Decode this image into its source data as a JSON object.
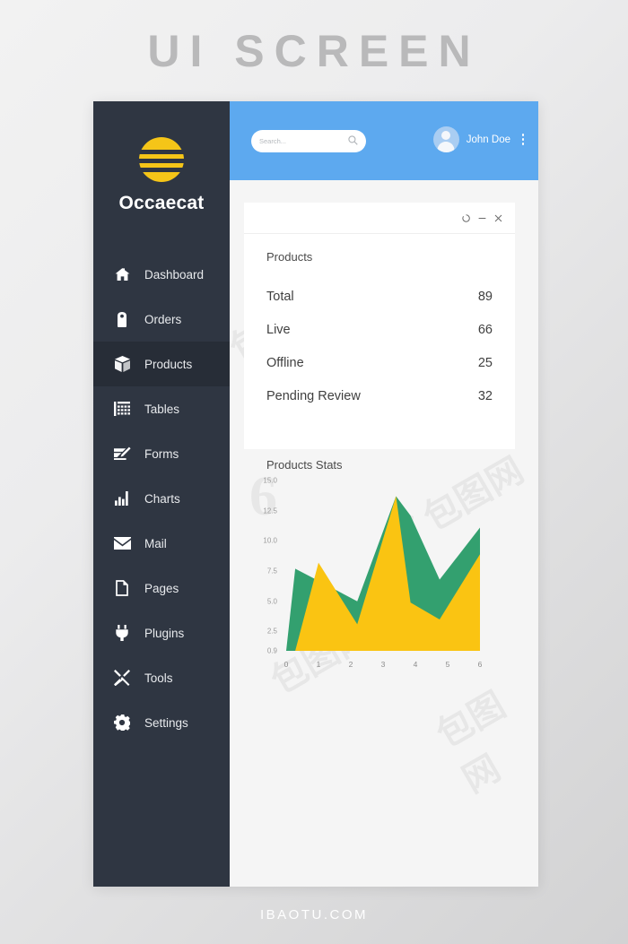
{
  "poster": {
    "title": "UI SCREEN",
    "footer": "IBAOTU.COM"
  },
  "colors": {
    "sidebar_bg": "#2f3642",
    "sidebar_active": "#272d37",
    "topbar_blue": "#5da9ef",
    "accent_yellow": "#f5c518",
    "chart_yellow": "#fac412",
    "chart_green": "#33a06f",
    "content_bg": "#f5f5f5",
    "card_bg": "#ffffff",
    "poster_title": "#b9b9ba"
  },
  "sidebar": {
    "brand": "Occaecat",
    "logo_icon": "striped-circle-logo",
    "items": [
      {
        "label": "Dashboard",
        "icon": "home-icon",
        "active": false
      },
      {
        "label": "Orders",
        "icon": "tag-icon",
        "active": false
      },
      {
        "label": "Products",
        "icon": "box-icon",
        "active": true
      },
      {
        "label": "Tables",
        "icon": "grid-icon",
        "active": false
      },
      {
        "label": "Forms",
        "icon": "form-pencil-icon",
        "active": false
      },
      {
        "label": "Charts",
        "icon": "bar-chart-icon",
        "active": false
      },
      {
        "label": "Mail",
        "icon": "envelope-icon",
        "active": false
      },
      {
        "label": "Pages",
        "icon": "page-icon",
        "active": false
      },
      {
        "label": "Plugins",
        "icon": "plug-icon",
        "active": false
      },
      {
        "label": "Tools",
        "icon": "wrench-screwdriver-icon",
        "active": false
      },
      {
        "label": "Settings",
        "icon": "gear-icon",
        "active": false
      }
    ]
  },
  "topbar": {
    "search": {
      "placeholder": "Search...",
      "value": "",
      "icon": "search-icon"
    },
    "user": {
      "name": "John Doe",
      "avatar_icon": "avatar-icon"
    },
    "menu_icon": "kebab-menu-icon"
  },
  "products_card": {
    "window_controls": [
      {
        "name": "refresh",
        "icon": "refresh-icon"
      },
      {
        "name": "minimize",
        "icon": "minimize-icon"
      },
      {
        "name": "close",
        "icon": "close-icon"
      }
    ],
    "title": "Products",
    "rows": [
      {
        "label": "Total",
        "value": "89"
      },
      {
        "label": "Live",
        "value": "66"
      },
      {
        "label": "Offline",
        "value": "25"
      },
      {
        "label": "Pending Review",
        "value": "32"
      }
    ]
  },
  "chart_data": {
    "type": "area",
    "title": "Products Stats",
    "xlabel": "",
    "ylabel": "",
    "x": [
      0,
      1,
      2,
      3,
      4,
      5,
      6
    ],
    "xlim": [
      0,
      6
    ],
    "ylim": [
      0.9,
      15.0
    ],
    "ytick_labels": [
      "0.9",
      "2.5",
      "5.0",
      "7.5",
      "10.0",
      "12.5",
      "15.0"
    ],
    "yticks": [
      0.9,
      2.5,
      5.0,
      7.5,
      10.0,
      12.5,
      15.0
    ],
    "xtick_labels": [
      "0",
      "1",
      "2",
      "3",
      "4",
      "5",
      "6"
    ],
    "grid": false,
    "legend": "none",
    "series": [
      {
        "name": "series-green",
        "color": "#33a06f",
        "values": [
          0.9,
          7.7,
          6.7,
          5.0,
          13.7,
          12.1,
          6.8,
          11.1
        ]
      },
      {
        "name": "series-yellow",
        "color": "#fac412",
        "values": [
          0.9,
          0.9,
          8.2,
          3.1,
          13.7,
          4.9,
          3.5,
          8.9
        ]
      }
    ],
    "series_x": [
      0,
      0.28,
      1,
      2.2,
      3.4,
      3.85,
      4.75,
      6
    ]
  },
  "watermarks": {
    "logo_glyph": "6",
    "cn_text": "包图网"
  }
}
